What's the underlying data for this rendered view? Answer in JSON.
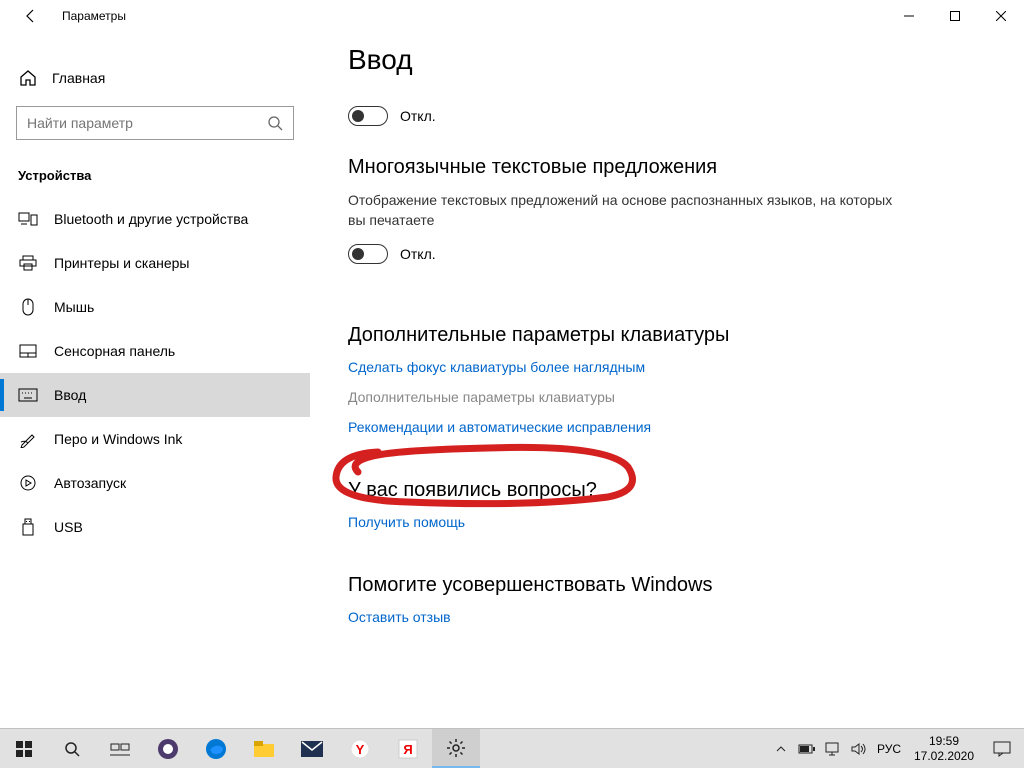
{
  "window": {
    "title": "Параметры"
  },
  "sidebar": {
    "home": "Главная",
    "search_placeholder": "Найти параметр",
    "category": "Устройства",
    "items": [
      {
        "label": "Bluetooth и другие устройства",
        "icon": "devices"
      },
      {
        "label": "Принтеры и сканеры",
        "icon": "printer"
      },
      {
        "label": "Мышь",
        "icon": "mouse"
      },
      {
        "label": "Сенсорная панель",
        "icon": "touchpad"
      },
      {
        "label": "Ввод",
        "icon": "keyboard",
        "selected": true
      },
      {
        "label": "Перо и Windows Ink",
        "icon": "pen"
      },
      {
        "label": "Автозапуск",
        "icon": "autoplay"
      },
      {
        "label": "USB",
        "icon": "usb"
      }
    ]
  },
  "main": {
    "title": "Ввод",
    "toggle1_label": "Откл.",
    "section_multi": "Многоязычные текстовые предложения",
    "multi_desc": "Отображение текстовых предложений на основе распознанных языков, на которых вы печатаете",
    "toggle2_label": "Откл.",
    "section_kbd": "Дополнительные параметры клавиатуры",
    "link_focus": "Сделать фокус клавиатуры более наглядным",
    "link_advanced": "Дополнительные параметры клавиатуры",
    "link_recom": "Рекомендации и автоматические исправления",
    "section_questions": "У вас появились вопросы?",
    "link_help": "Получить помощь",
    "section_feedback": "Помогите усовершенствовать Windows",
    "link_feedback": "Оставить отзыв"
  },
  "taskbar": {
    "lang": "РУС",
    "time": "19:59",
    "date": "17.02.2020"
  }
}
